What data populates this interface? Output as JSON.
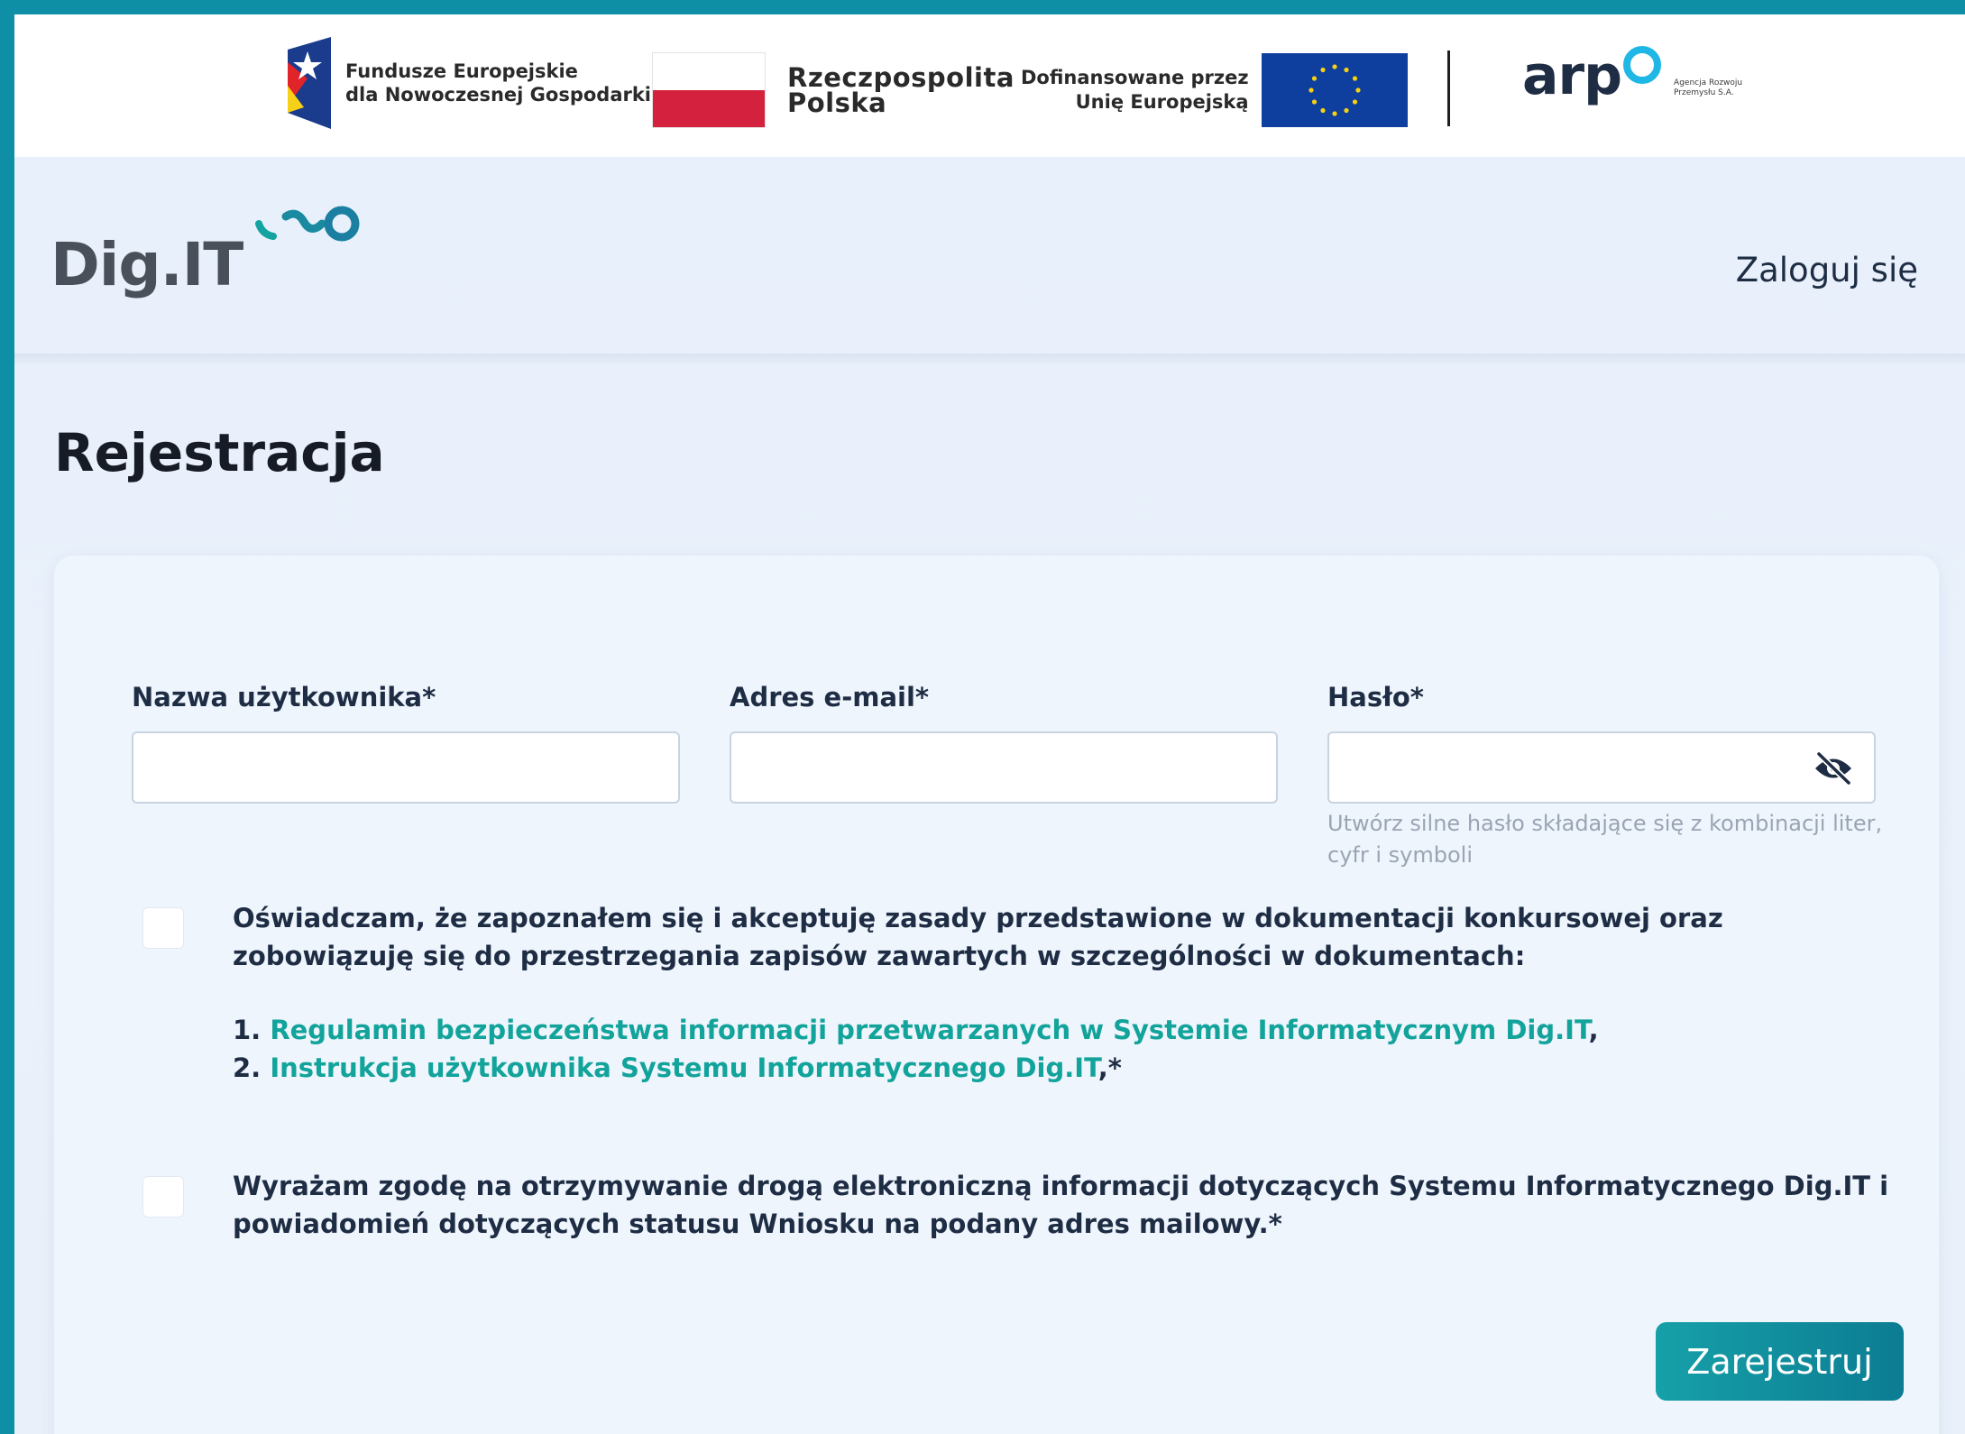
{
  "sponsors": {
    "fe": {
      "line1": "Fundusze Europejskie",
      "line2": "dla Nowoczesnej Gospodarki"
    },
    "rp": {
      "line1": "Rzeczpospolita",
      "line2": "Polska"
    },
    "eu": {
      "line1": "Dofinansowane przez",
      "line2": "Unię Europejską"
    },
    "arp": {
      "name": "arp",
      "sub1": "Agencja Rozwoju",
      "sub2": "Przemysłu S.A."
    }
  },
  "header": {
    "brand": "Dig.IT",
    "login_link": "Zaloguj się"
  },
  "page": {
    "title": "Rejestracja"
  },
  "form": {
    "username": {
      "label": "Nazwa użytkownika*",
      "value": ""
    },
    "email": {
      "label": "Adres e-mail*",
      "value": ""
    },
    "password": {
      "label": "Hasło*",
      "value": "",
      "hint": "Utwórz silne hasło składające się z kombinacji liter, cyfr i symboli"
    },
    "consent1": {
      "text": "Oświadczam, że zapoznałem się i akceptuję zasady przedstawione w dokumentacji konkursowej oraz zobowiązuję się do przestrzegania zapisów zawartych w szczególności w dokumentach:",
      "checked": false,
      "items": [
        {
          "num": "1.",
          "link": "Regulamin bezpieczeństwa informacji przetwarzanych w Systemie Informatycznym Dig.IT",
          "suffix": ","
        },
        {
          "num": "2.",
          "link": "Instrukcja użytkownika Systemu Informatycznego Dig.IT",
          "suffix": ",*"
        }
      ]
    },
    "consent2": {
      "text": "Wyrażam zgodę na otrzymywanie drogą elektroniczną informacji dotyczących Systemu Informatycznego Dig.IT i powiadomień dotyczących statusu Wniosku na podany adres mailowy.*",
      "checked": false
    },
    "submit_label": "Zarejestruj"
  },
  "colors": {
    "frame": "#0e8fa6",
    "accent_link": "#12a39b",
    "button": "#0c7c93",
    "text": "#1e2d44"
  },
  "icons": {
    "password_toggle": "eye-slash-icon",
    "brand_mark": "dig-it-logo-icon"
  }
}
